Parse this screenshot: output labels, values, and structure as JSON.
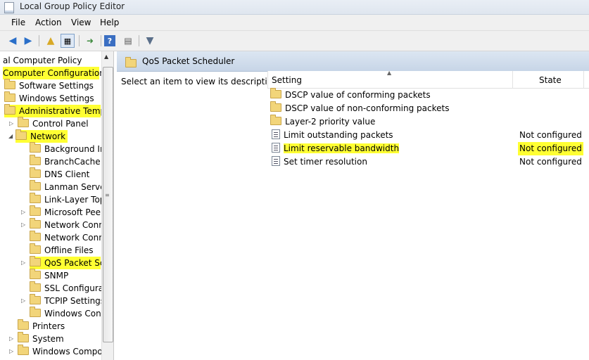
{
  "window": {
    "title": "Local Group Policy Editor"
  },
  "menu": [
    "File",
    "Action",
    "View",
    "Help"
  ],
  "toolbar_icons": [
    "back-arrow-icon",
    "forward-arrow-icon",
    "up-folder-icon",
    "show-hide-tree-icon",
    "export-list-icon",
    "help-icon",
    "properties-icon",
    "filter-icon"
  ],
  "tree": [
    {
      "label": "al Computer Policy",
      "highlight": false
    },
    {
      "label": "Computer Configuration",
      "highlight": true
    },
    {
      "label": "Software Settings",
      "highlight": false
    },
    {
      "label": "Windows Settings",
      "highlight": false
    },
    {
      "label": "Administrative Templa",
      "highlight": true
    },
    {
      "label": "Control Panel",
      "highlight": false
    },
    {
      "label": "Network",
      "highlight": true
    },
    {
      "label": "Background Int",
      "highlight": false
    },
    {
      "label": "BranchCache",
      "highlight": false
    },
    {
      "label": "DNS Client",
      "highlight": false
    },
    {
      "label": "Lanman Server",
      "highlight": false
    },
    {
      "label": "Link-Layer Topo",
      "highlight": false
    },
    {
      "label": "Microsoft Peer-",
      "highlight": false
    },
    {
      "label": "Network Conne",
      "highlight": false
    },
    {
      "label": "Network Conne",
      "highlight": false
    },
    {
      "label": "Offline Files",
      "highlight": false
    },
    {
      "label": "QoS Packet Sch",
      "highlight": true
    },
    {
      "label": "SNMP",
      "highlight": false
    },
    {
      "label": "SSL Configurati",
      "highlight": false
    },
    {
      "label": "TCPIP Settings",
      "highlight": false
    },
    {
      "label": "Windows Conn",
      "highlight": false
    },
    {
      "label": "Printers",
      "highlight": false
    },
    {
      "label": "System",
      "highlight": false
    },
    {
      "label": "Windows Compon",
      "highlight": false
    }
  ],
  "right_panel": {
    "title": "QoS Packet Scheduler",
    "description": "Select an item to view its description.",
    "columns": {
      "setting": "Setting",
      "state": "State"
    },
    "rows": [
      {
        "type": "folder",
        "setting": "DSCP value of conforming packets",
        "state": "",
        "highlight": false
      },
      {
        "type": "folder",
        "setting": "DSCP value of non-conforming packets",
        "state": "",
        "highlight": false
      },
      {
        "type": "folder",
        "setting": "Layer-2 priority value",
        "state": "",
        "highlight": false
      },
      {
        "type": "policy",
        "setting": "Limit outstanding packets",
        "state": "Not configured",
        "highlight": false
      },
      {
        "type": "policy",
        "setting": "Limit reservable bandwidth",
        "state": "Not configured",
        "highlight": true
      },
      {
        "type": "policy",
        "setting": "Set timer resolution",
        "state": "Not configured",
        "highlight": false
      }
    ]
  },
  "colors": {
    "highlight": "#ffff33",
    "header_bg": "#c7d5e7"
  }
}
